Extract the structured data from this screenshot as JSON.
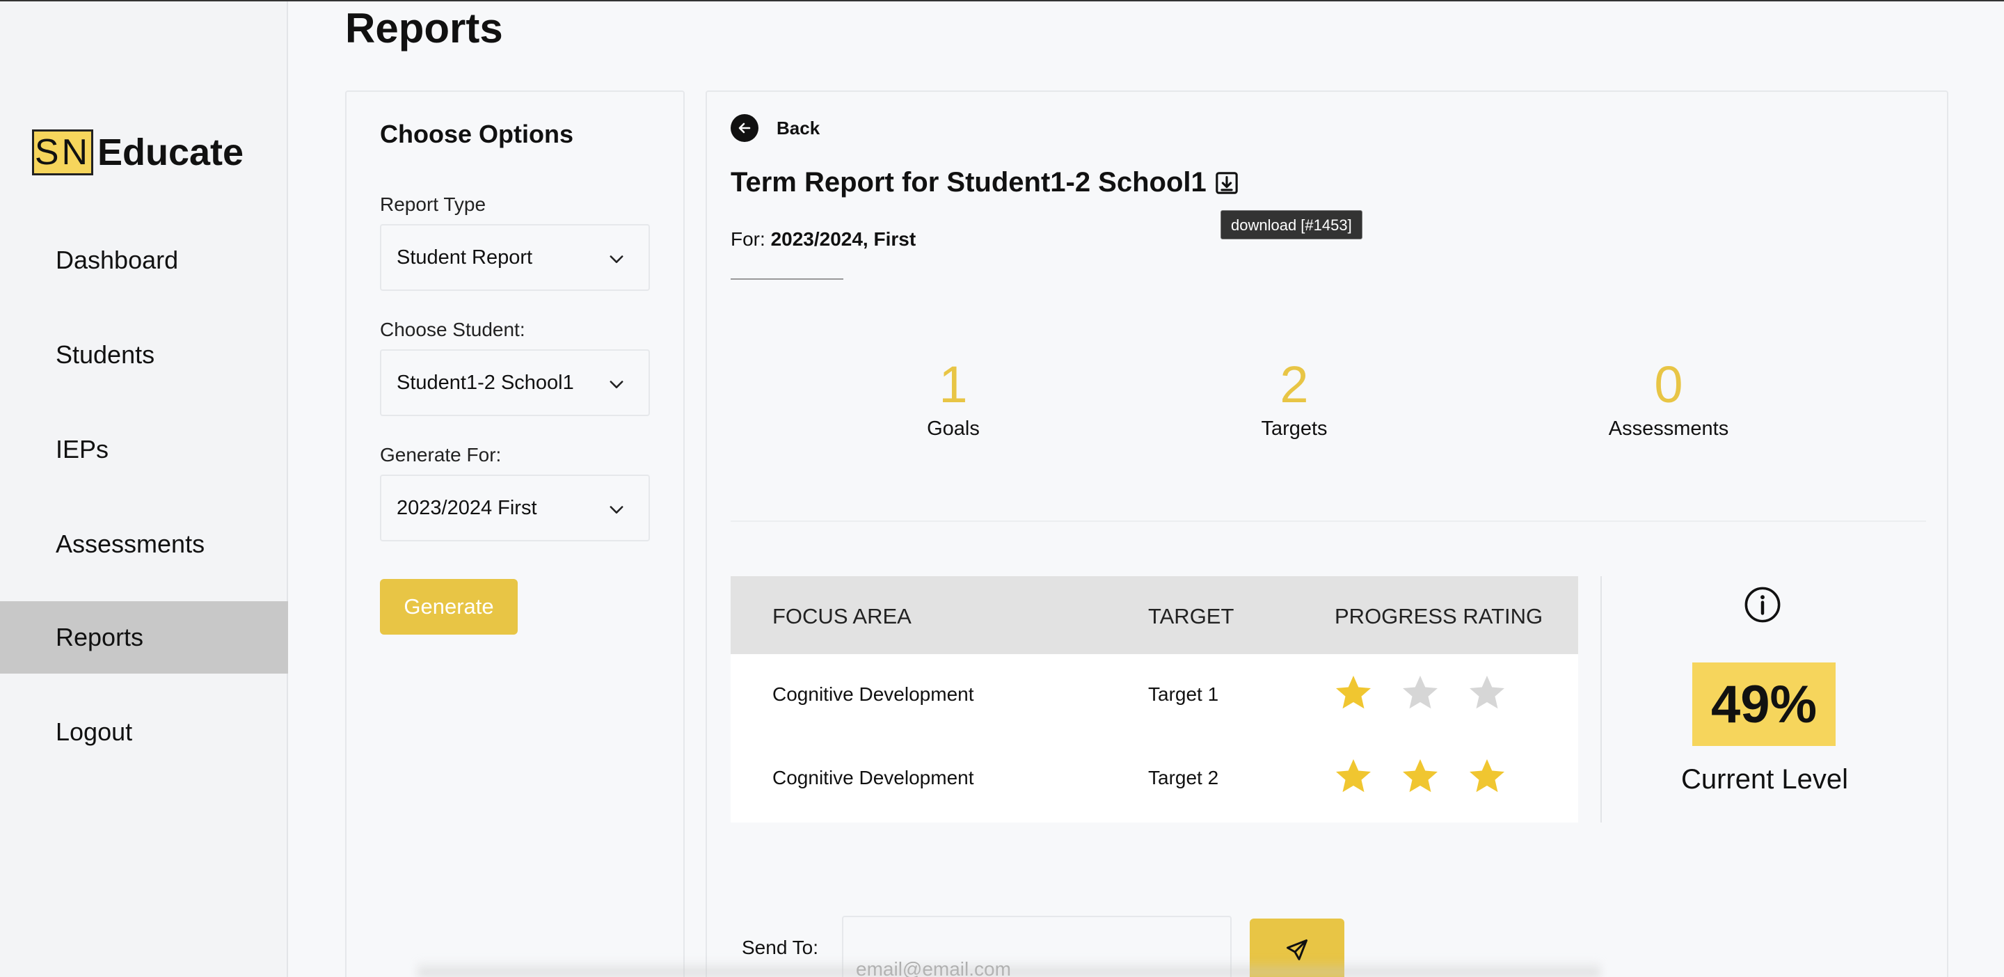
{
  "page": {
    "title": "Reports"
  },
  "brand": {
    "sn": "SN",
    "name": "Educate",
    "accent_color": "#f6d55c"
  },
  "sidebar": {
    "items": [
      {
        "label": "Dashboard",
        "active": false
      },
      {
        "label": "Students",
        "active": false
      },
      {
        "label": "IEPs",
        "active": false
      },
      {
        "label": "Assessments",
        "active": false
      },
      {
        "label": "Reports",
        "active": true
      },
      {
        "label": "Logout",
        "active": false
      }
    ]
  },
  "options": {
    "title": "Choose Options",
    "report_type": {
      "label": "Report Type",
      "value": "Student Report"
    },
    "student": {
      "label": "Choose Student:",
      "value": "Student1-2 School1"
    },
    "generate_for": {
      "label": "Generate For:",
      "value": "2023/2024 First"
    },
    "generate_label": "Generate"
  },
  "report": {
    "back_label": "Back",
    "title": "Term Report for Student1-2 School1",
    "tooltip": "download [#1453]",
    "for_prefix": "For:",
    "for_value": "2023/2024, First",
    "stats": [
      {
        "value": "1",
        "label": "Goals"
      },
      {
        "value": "2",
        "label": "Targets"
      },
      {
        "value": "0",
        "label": "Assessments"
      }
    ],
    "table": {
      "headers": [
        "FOCUS AREA",
        "TARGET",
        "PROGRESS RATING"
      ],
      "rows": [
        {
          "focus_area": "Cognitive Development",
          "target": "Target 1",
          "rating": 1,
          "max_rating": 3
        },
        {
          "focus_area": "Cognitive Development",
          "target": "Target 2",
          "rating": 3,
          "max_rating": 3
        }
      ]
    },
    "current_level": {
      "value": "49%",
      "label": "Current Level"
    },
    "send": {
      "label": "Send To:",
      "placeholder": "email@email.com"
    }
  },
  "colors": {
    "star_filled": "#f0c630",
    "star_empty": "#d6d6d6",
    "button": "#e8c545"
  }
}
